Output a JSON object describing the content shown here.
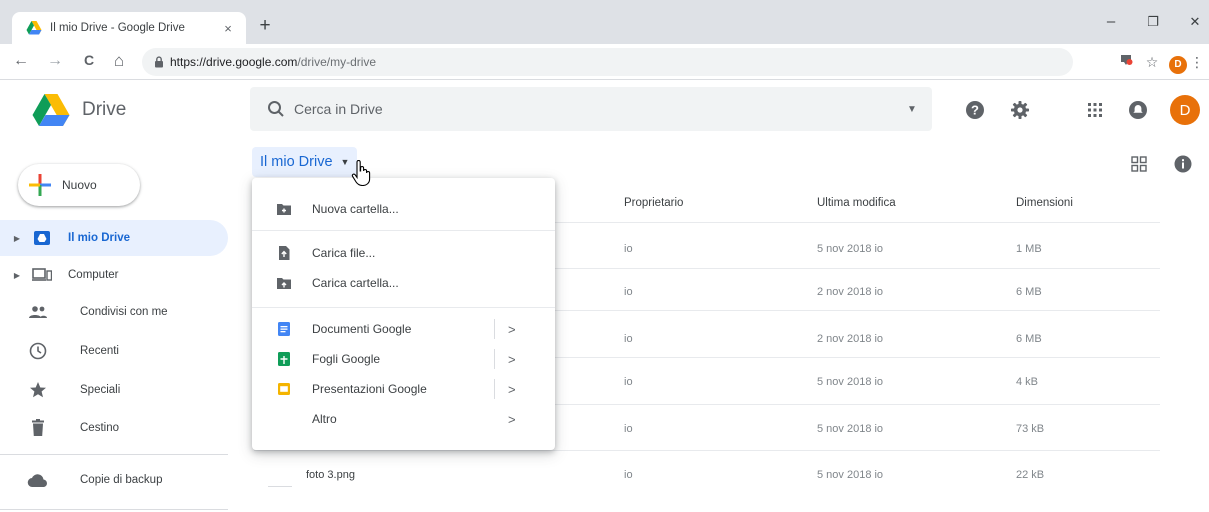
{
  "browser": {
    "tab_title": "Il mio Drive - Google Drive",
    "tab_close": "×",
    "new_tab": "+",
    "url_host": "https://drive.google.com",
    "url_path": "/drive/my-drive",
    "profile_initial": "D",
    "window_controls": {
      "minimize": "–",
      "restore": "❐",
      "close": "✕"
    },
    "nav": {
      "back": "←",
      "forward": "→",
      "reload": "C",
      "home": "⌂"
    },
    "bookmark_star": "☆",
    "menu": "⋮"
  },
  "header": {
    "app_name": "Drive",
    "search_placeholder": "Cerca in Drive",
    "avatar_initial": "D"
  },
  "sidebar": {
    "new_button": "Nuovo",
    "items": [
      {
        "label": "Il mio Drive",
        "icon": "my-drive-icon",
        "active": true
      },
      {
        "label": "Computer",
        "icon": "computer-icon"
      },
      {
        "label": "Condivisi con me",
        "icon": "shared-icon"
      },
      {
        "label": "Recenti",
        "icon": "clock-icon"
      },
      {
        "label": "Speciali",
        "icon": "star-icon"
      },
      {
        "label": "Cestino",
        "icon": "trash-icon"
      },
      {
        "label": "Copie di backup",
        "icon": "cloud-icon"
      }
    ]
  },
  "main": {
    "breadcrumb": "Il mio Drive",
    "columns": {
      "owner": "Proprietario",
      "modified": "Ultima modifica",
      "size": "Dimensioni"
    },
    "rows": [
      {
        "name": "",
        "owner": "io",
        "modified": "5 nov 2018 io",
        "size": "1 MB"
      },
      {
        "name": "",
        "owner": "io",
        "modified": "2 nov 2018 io",
        "size": "6 MB"
      },
      {
        "name": "",
        "owner": "io",
        "modified": "2 nov 2018 io",
        "size": "6 MB"
      },
      {
        "name": "",
        "owner": "io",
        "modified": "5 nov 2018 io",
        "size": "4 kB"
      },
      {
        "name": "",
        "owner": "io",
        "modified": "5 nov 2018 io",
        "size": "73 kB"
      },
      {
        "name": "foto 3.png",
        "owner": "io",
        "modified": "5 nov 2018 io",
        "size": "22 kB"
      }
    ]
  },
  "menu": {
    "items": [
      {
        "label": "Nuova cartella...",
        "icon": "new-folder-icon"
      },
      {
        "label": "Carica file...",
        "icon": "upload-file-icon"
      },
      {
        "label": "Carica cartella...",
        "icon": "upload-folder-icon"
      },
      {
        "label": "Documenti Google",
        "icon": "google-docs-icon",
        "chevron": ">"
      },
      {
        "label": "Fogli Google",
        "icon": "google-sheets-icon",
        "chevron": ">"
      },
      {
        "label": "Presentazioni Google",
        "icon": "google-slides-icon",
        "chevron": ">"
      },
      {
        "label": "Altro",
        "icon": "",
        "chevron": ">"
      }
    ]
  },
  "colors": {
    "accent": "#1967d2",
    "active_bg": "#e8f0fe",
    "avatar": "#e8710a",
    "docs": "#4285f4",
    "sheets": "#0f9d58",
    "slides": "#f4b400"
  }
}
